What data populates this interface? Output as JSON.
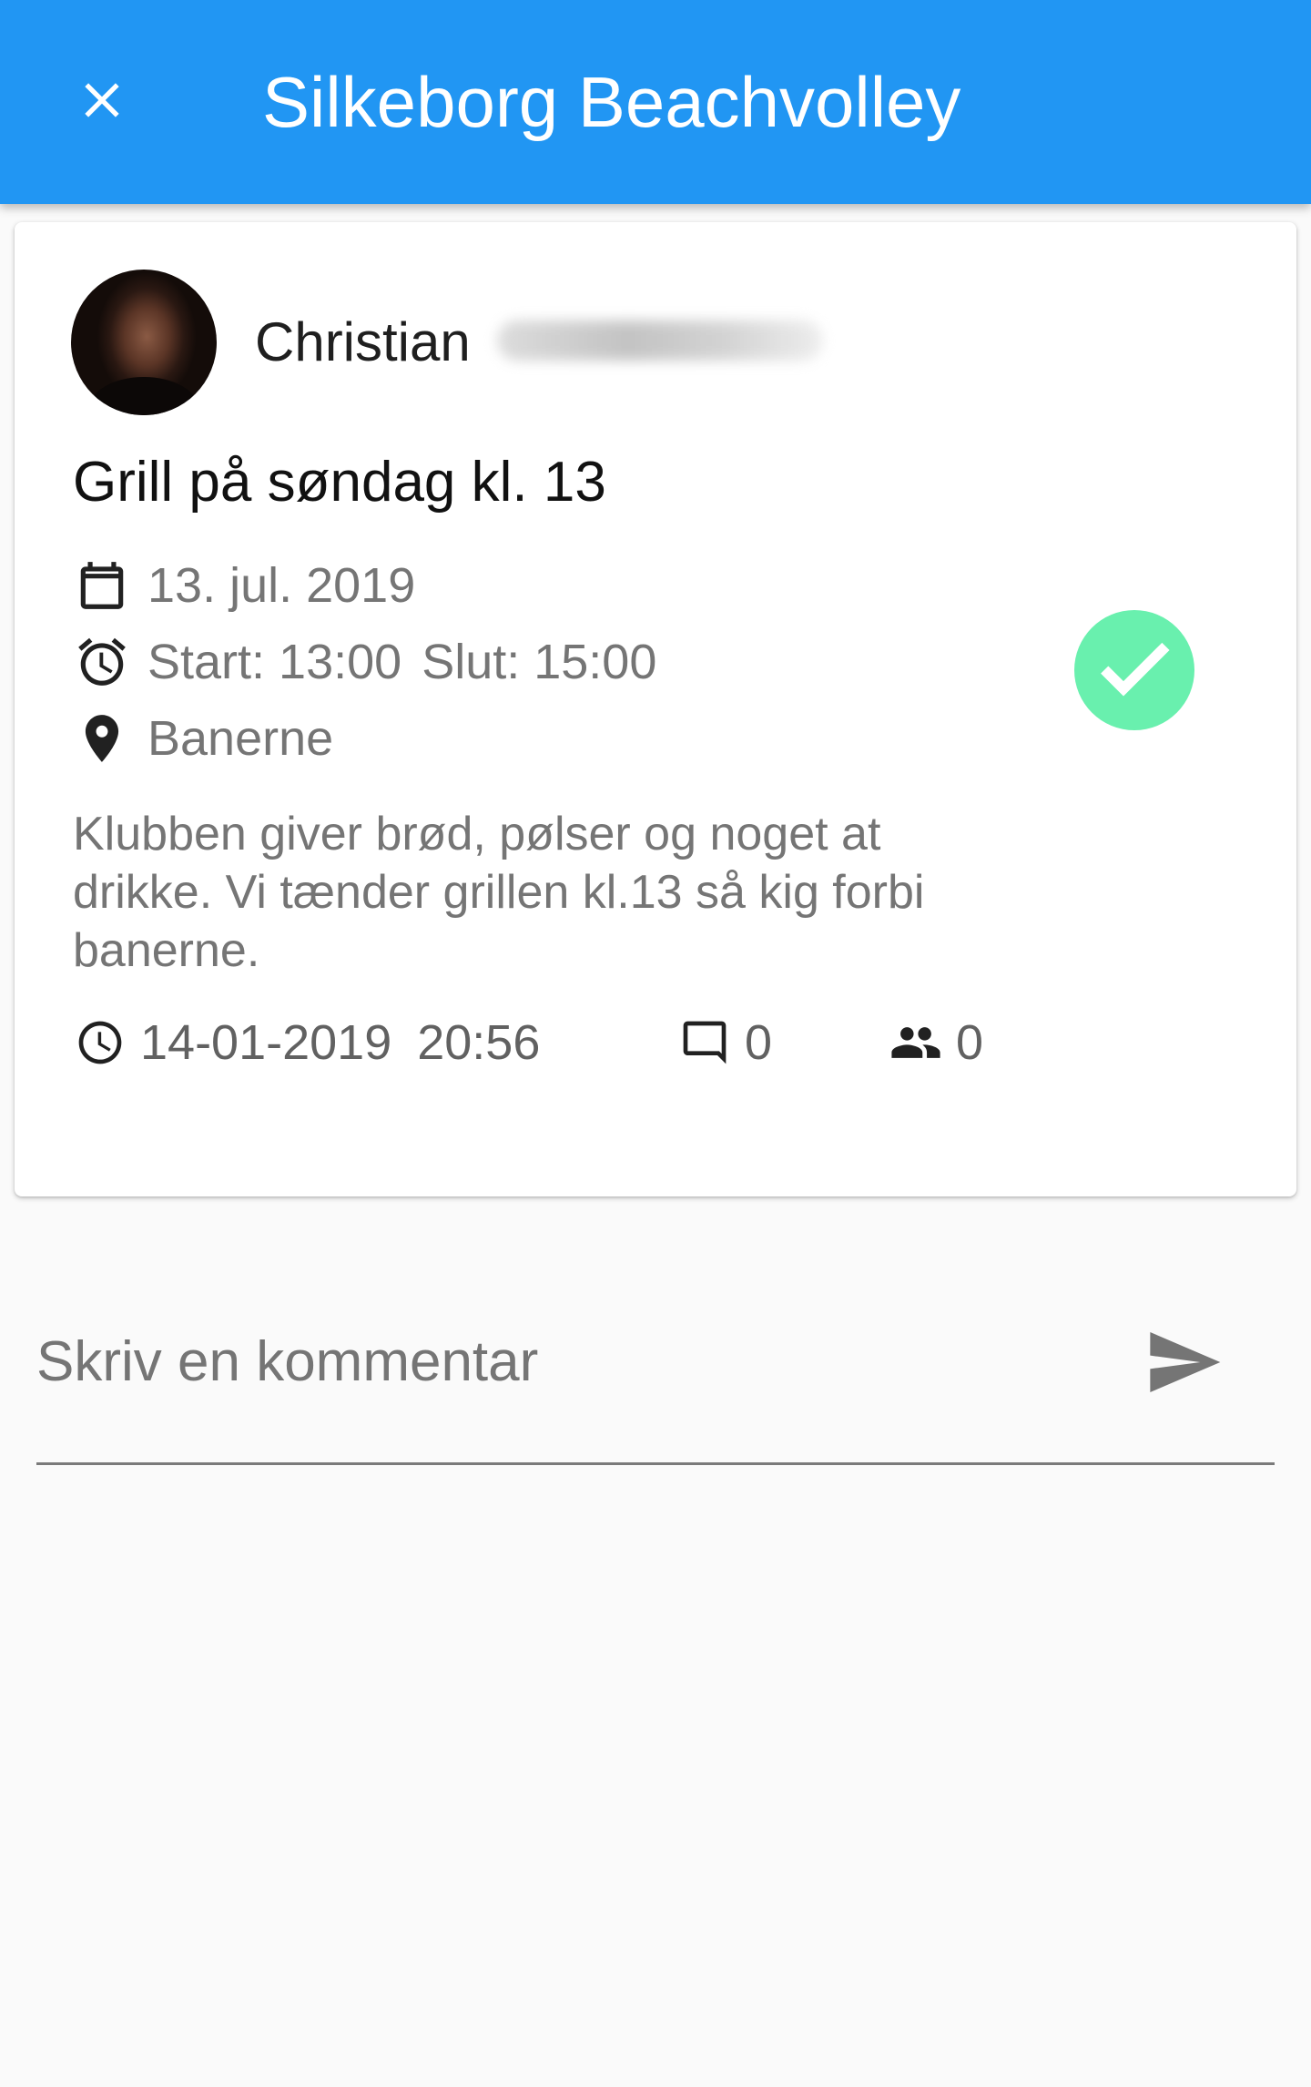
{
  "appbar": {
    "title": "Silkeborg Beachvolley",
    "close_icon": "close-icon",
    "background": "#2196f3"
  },
  "post": {
    "author_name": "Christian",
    "event_title": "Grill på søndag kl. 13",
    "date": "13. jul. 2019",
    "start": "Start: 13:00",
    "end": "Slut: 15:00",
    "location": "Banerne",
    "description": "Klubben giver brød, pølser og noget at drikke. Vi tænder grillen kl.13 så kig forbi banerne.",
    "attending_icon": "check-icon",
    "attending_color": "#69f0ae",
    "meta": {
      "posted_date": "14-01-2019",
      "posted_time": "20:56",
      "comment_count": "0",
      "participant_count": "0"
    }
  },
  "comment": {
    "placeholder": "Skriv en kommentar",
    "send_icon": "send-icon"
  }
}
